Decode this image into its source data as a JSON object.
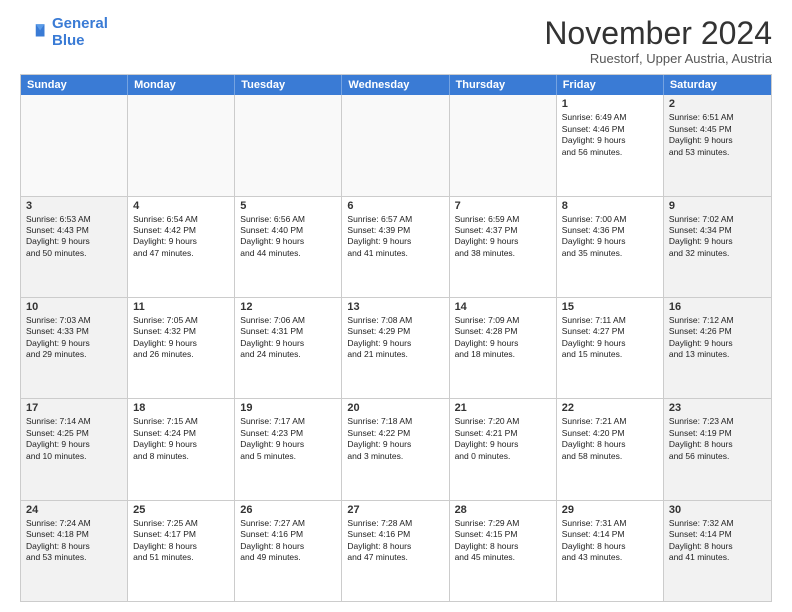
{
  "logo": {
    "line1": "General",
    "line2": "Blue"
  },
  "title": "November 2024",
  "location": "Ruestorf, Upper Austria, Austria",
  "days_of_week": [
    "Sunday",
    "Monday",
    "Tuesday",
    "Wednesday",
    "Thursday",
    "Friday",
    "Saturday"
  ],
  "weeks": [
    [
      {
        "day": "",
        "text": "",
        "empty": true
      },
      {
        "day": "",
        "text": "",
        "empty": true
      },
      {
        "day": "",
        "text": "",
        "empty": true
      },
      {
        "day": "",
        "text": "",
        "empty": true
      },
      {
        "day": "",
        "text": "",
        "empty": true
      },
      {
        "day": "1",
        "text": "Sunrise: 6:49 AM\nSunset: 4:46 PM\nDaylight: 9 hours\nand 56 minutes.",
        "empty": false
      },
      {
        "day": "2",
        "text": "Sunrise: 6:51 AM\nSunset: 4:45 PM\nDaylight: 9 hours\nand 53 minutes.",
        "empty": false,
        "shaded": true
      }
    ],
    [
      {
        "day": "3",
        "text": "Sunrise: 6:53 AM\nSunset: 4:43 PM\nDaylight: 9 hours\nand 50 minutes.",
        "empty": false,
        "shaded": true
      },
      {
        "day": "4",
        "text": "Sunrise: 6:54 AM\nSunset: 4:42 PM\nDaylight: 9 hours\nand 47 minutes.",
        "empty": false
      },
      {
        "day": "5",
        "text": "Sunrise: 6:56 AM\nSunset: 4:40 PM\nDaylight: 9 hours\nand 44 minutes.",
        "empty": false
      },
      {
        "day": "6",
        "text": "Sunrise: 6:57 AM\nSunset: 4:39 PM\nDaylight: 9 hours\nand 41 minutes.",
        "empty": false
      },
      {
        "day": "7",
        "text": "Sunrise: 6:59 AM\nSunset: 4:37 PM\nDaylight: 9 hours\nand 38 minutes.",
        "empty": false
      },
      {
        "day": "8",
        "text": "Sunrise: 7:00 AM\nSunset: 4:36 PM\nDaylight: 9 hours\nand 35 minutes.",
        "empty": false
      },
      {
        "day": "9",
        "text": "Sunrise: 7:02 AM\nSunset: 4:34 PM\nDaylight: 9 hours\nand 32 minutes.",
        "empty": false,
        "shaded": true
      }
    ],
    [
      {
        "day": "10",
        "text": "Sunrise: 7:03 AM\nSunset: 4:33 PM\nDaylight: 9 hours\nand 29 minutes.",
        "empty": false,
        "shaded": true
      },
      {
        "day": "11",
        "text": "Sunrise: 7:05 AM\nSunset: 4:32 PM\nDaylight: 9 hours\nand 26 minutes.",
        "empty": false
      },
      {
        "day": "12",
        "text": "Sunrise: 7:06 AM\nSunset: 4:31 PM\nDaylight: 9 hours\nand 24 minutes.",
        "empty": false
      },
      {
        "day": "13",
        "text": "Sunrise: 7:08 AM\nSunset: 4:29 PM\nDaylight: 9 hours\nand 21 minutes.",
        "empty": false
      },
      {
        "day": "14",
        "text": "Sunrise: 7:09 AM\nSunset: 4:28 PM\nDaylight: 9 hours\nand 18 minutes.",
        "empty": false
      },
      {
        "day": "15",
        "text": "Sunrise: 7:11 AM\nSunset: 4:27 PM\nDaylight: 9 hours\nand 15 minutes.",
        "empty": false
      },
      {
        "day": "16",
        "text": "Sunrise: 7:12 AM\nSunset: 4:26 PM\nDaylight: 9 hours\nand 13 minutes.",
        "empty": false,
        "shaded": true
      }
    ],
    [
      {
        "day": "17",
        "text": "Sunrise: 7:14 AM\nSunset: 4:25 PM\nDaylight: 9 hours\nand 10 minutes.",
        "empty": false,
        "shaded": true
      },
      {
        "day": "18",
        "text": "Sunrise: 7:15 AM\nSunset: 4:24 PM\nDaylight: 9 hours\nand 8 minutes.",
        "empty": false
      },
      {
        "day": "19",
        "text": "Sunrise: 7:17 AM\nSunset: 4:23 PM\nDaylight: 9 hours\nand 5 minutes.",
        "empty": false
      },
      {
        "day": "20",
        "text": "Sunrise: 7:18 AM\nSunset: 4:22 PM\nDaylight: 9 hours\nand 3 minutes.",
        "empty": false
      },
      {
        "day": "21",
        "text": "Sunrise: 7:20 AM\nSunset: 4:21 PM\nDaylight: 9 hours\nand 0 minutes.",
        "empty": false
      },
      {
        "day": "22",
        "text": "Sunrise: 7:21 AM\nSunset: 4:20 PM\nDaylight: 8 hours\nand 58 minutes.",
        "empty": false
      },
      {
        "day": "23",
        "text": "Sunrise: 7:23 AM\nSunset: 4:19 PM\nDaylight: 8 hours\nand 56 minutes.",
        "empty": false,
        "shaded": true
      }
    ],
    [
      {
        "day": "24",
        "text": "Sunrise: 7:24 AM\nSunset: 4:18 PM\nDaylight: 8 hours\nand 53 minutes.",
        "empty": false,
        "shaded": true
      },
      {
        "day": "25",
        "text": "Sunrise: 7:25 AM\nSunset: 4:17 PM\nDaylight: 8 hours\nand 51 minutes.",
        "empty": false
      },
      {
        "day": "26",
        "text": "Sunrise: 7:27 AM\nSunset: 4:16 PM\nDaylight: 8 hours\nand 49 minutes.",
        "empty": false
      },
      {
        "day": "27",
        "text": "Sunrise: 7:28 AM\nSunset: 4:16 PM\nDaylight: 8 hours\nand 47 minutes.",
        "empty": false
      },
      {
        "day": "28",
        "text": "Sunrise: 7:29 AM\nSunset: 4:15 PM\nDaylight: 8 hours\nand 45 minutes.",
        "empty": false
      },
      {
        "day": "29",
        "text": "Sunrise: 7:31 AM\nSunset: 4:14 PM\nDaylight: 8 hours\nand 43 minutes.",
        "empty": false
      },
      {
        "day": "30",
        "text": "Sunrise: 7:32 AM\nSunset: 4:14 PM\nDaylight: 8 hours\nand 41 minutes.",
        "empty": false,
        "shaded": true
      }
    ]
  ]
}
